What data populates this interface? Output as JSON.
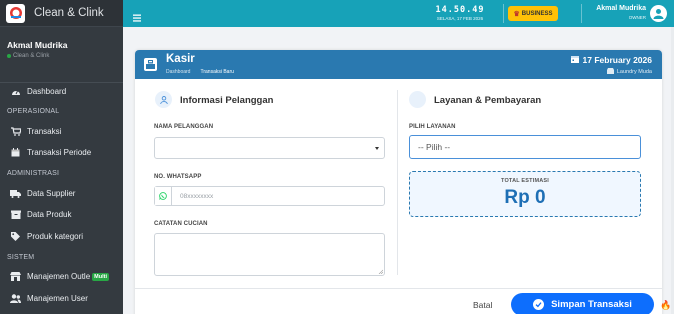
{
  "brand": {
    "name": "Clean & Clink"
  },
  "user_panel": {
    "name": "Akmal Mudrika",
    "status": "Clean & Clink"
  },
  "sidebar": {
    "dashboard": "Dashboard",
    "header_operasional": "OPERASIONAL",
    "transaksi": "Transaksi",
    "transaksi_periode": "Transaksi Periode",
    "header_administrasi": "ADMINISTRASI",
    "data_supplier": "Data Supplier",
    "data_produk": "Data Produk",
    "produk_kategori": "Produk kategori",
    "header_sistem": "SISTEM",
    "manajemen_outlet": "Manajemen Outle",
    "multi_badge": "Multi",
    "manajemen_user": "Manajemen User"
  },
  "topbar": {
    "time": "14.50.49",
    "date": "SELASA, 17 FEB 2026",
    "plan": "BUSINESS",
    "user_name": "Akmal Mudrika",
    "user_role": "OWNER"
  },
  "page": {
    "title": "Kasir",
    "breadcrumb": [
      "Dashboard",
      "Transaksi Baru"
    ],
    "date": "17 February 2026",
    "shop": "Laundry Muda"
  },
  "customer": {
    "title": "Informasi Pelanggan",
    "name_label": "NAMA PELANGGAN",
    "name_value": "",
    "wa_label": "NO. WHATSAPP",
    "wa_placeholder": "08xxxxxxxx",
    "note_label": "CATATAN CUCIAN",
    "note_value": ""
  },
  "service": {
    "title": "Layanan & Pembayaran",
    "pilih_label": "PILIH LAYANAN",
    "pilih_value": "-- Pilih --",
    "total_label": "TOTAL ESTIMASI",
    "total_value": "Rp 0"
  },
  "actions": {
    "cancel": "Batal",
    "save": "Simpan Transaksi"
  },
  "colors": {
    "topbar": "#17a2b8",
    "sidebar": "#343a40",
    "header": "#2a79b0",
    "primary": "#0d6efd",
    "business": "#ffc107"
  }
}
